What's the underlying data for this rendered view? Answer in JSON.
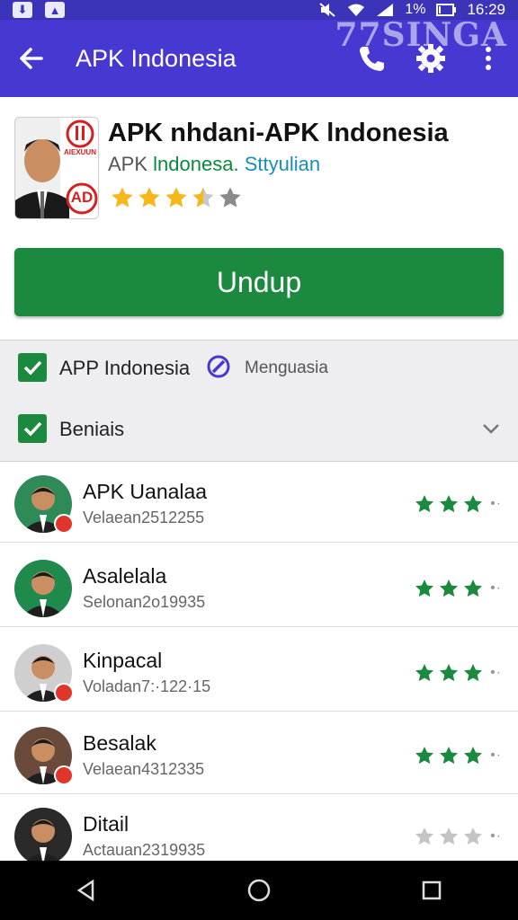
{
  "status": {
    "time": "16:29",
    "battery": "1%",
    "watermark": "77SINGA"
  },
  "appbar": {
    "title": "APK Indonesia"
  },
  "app": {
    "title": "APK nhdani-APK lndonesia",
    "sub_prefix": "APK",
    "sub_green": "lndonesa.",
    "sub_blue": "Sttyulian",
    "icon_text": "AD",
    "icon_caption": "AIEXUUN",
    "rating": 3.5
  },
  "download_button": "Undup",
  "filters": {
    "app_label": "APP Indonesia",
    "lang_label": "Menguasia",
    "sort_label": "Beniais"
  },
  "rows": [
    {
      "name": "APK Uanalaa",
      "sub": "Velaean2512255",
      "rating": 3
    },
    {
      "name": "Asalelala",
      "sub": "Selonan2o19935",
      "rating": 3
    },
    {
      "name": "Kinpacal",
      "sub": "Voladan7:·122·15",
      "rating": 3
    },
    {
      "name": "Besalak",
      "sub": "Velaean4312335",
      "rating": 3
    },
    {
      "name": "Ditail",
      "sub": "Actauan2319935",
      "rating": 0
    }
  ],
  "colors": {
    "accent": "#4638d0",
    "green": "#1c8a3e",
    "star_gold": "#f5b71a",
    "star_green": "#1c8a3e"
  }
}
